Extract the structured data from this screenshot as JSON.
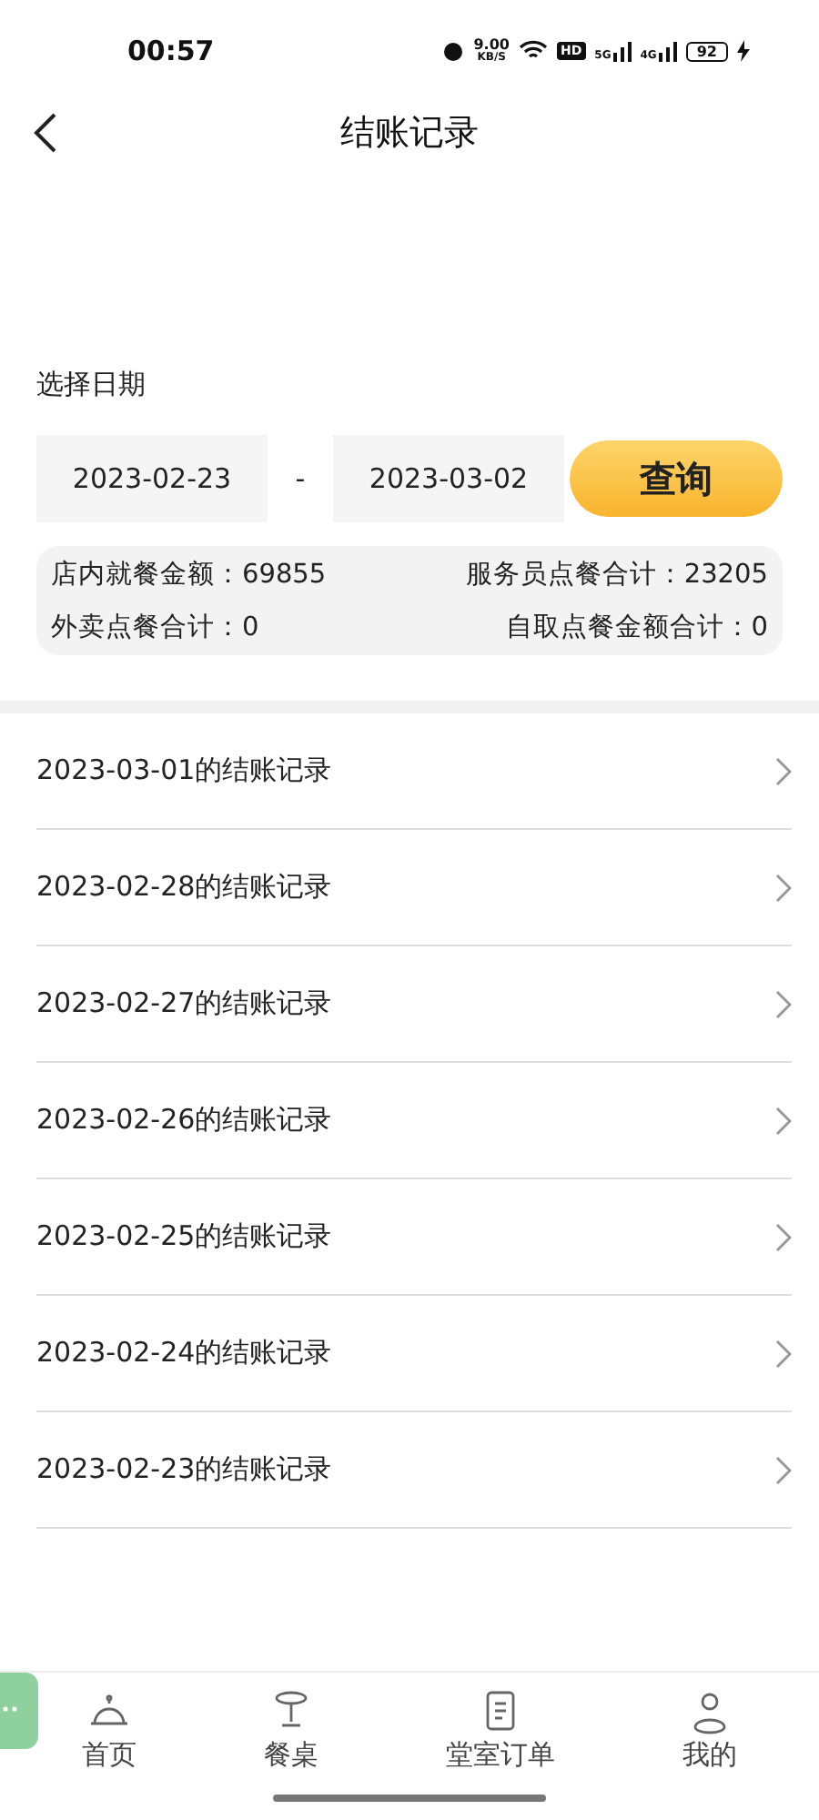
{
  "status_bar": {
    "time": "00:57",
    "net_speed": "9.00",
    "net_unit": "KB/S",
    "hd": "HD",
    "sim1": "5G",
    "sim2": "4G",
    "battery": "92"
  },
  "header": {
    "title": "结账记录"
  },
  "date_filter": {
    "label": "选择日期",
    "start": "2023-02-23",
    "separator": "-",
    "end": "2023-03-02",
    "button": "查询"
  },
  "summary": [
    {
      "label": "店内就餐金额：",
      "value": "69855"
    },
    {
      "label": "服务员点餐合计：",
      "value": "23205"
    },
    {
      "label": "外卖点餐合计：",
      "value": "0"
    },
    {
      "label": "自取点餐金额合计：",
      "value": "0"
    }
  ],
  "records": [
    "2023-03-01的结账记录",
    "2023-02-28的结账记录",
    "2023-02-27的结账记录",
    "2023-02-26的结账记录",
    "2023-02-25的结账记录",
    "2023-02-24的结账记录",
    "2023-02-23的结账记录"
  ],
  "tab_bar": [
    {
      "kind": "bell",
      "label": "首页",
      "selected": false
    },
    {
      "kind": "table",
      "label": "餐桌",
      "selected": false
    },
    {
      "kind": "receipt",
      "label": "堂室订单",
      "selected": false
    },
    {
      "kind": "person",
      "label": "我的",
      "selected": false
    }
  ]
}
